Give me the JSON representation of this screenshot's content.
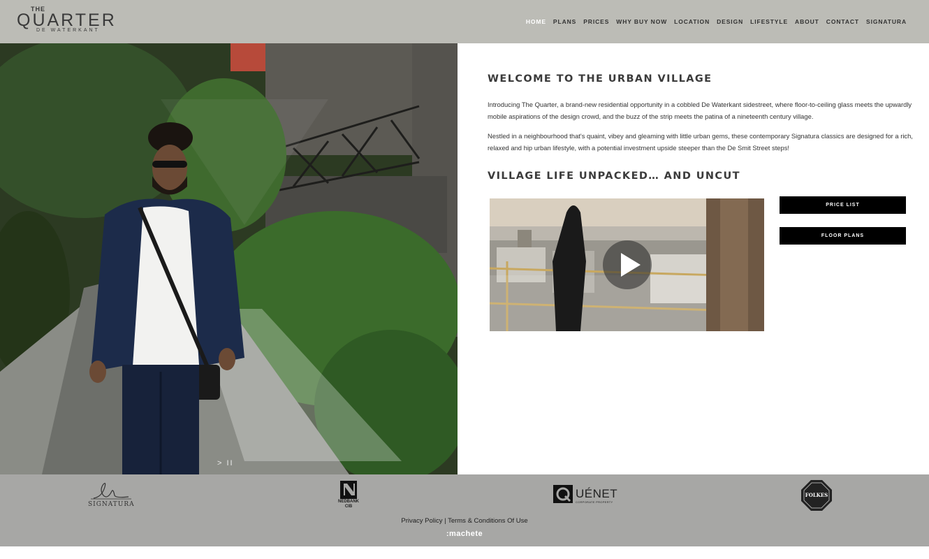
{
  "logo": {
    "line1": "THE",
    "line2": "QUARTER",
    "line3": "DE WATERKANT"
  },
  "nav": [
    {
      "label": "HOME",
      "active": true
    },
    {
      "label": "PLANS"
    },
    {
      "label": "PRICES"
    },
    {
      "label": "WHY BUY NOW"
    },
    {
      "label": "LOCATION"
    },
    {
      "label": "DESIGN"
    },
    {
      "label": "LIFESTYLE"
    },
    {
      "label": "ABOUT"
    },
    {
      "label": "CONTACT"
    },
    {
      "label": "SIGNATURA"
    }
  ],
  "hero": {
    "slider_controls": "> II"
  },
  "main": {
    "welcome_title": "WELCOME TO THE URBAN VILLAGE",
    "paragraph1": "Introducing The Quarter, a brand-new residential opportunity in a cobbled De Waterkant sidestreet, where floor-to-ceiling glass meets the upwardly mobile aspirations of the design crowd, and the buzz of the strip meets the patina of a nineteenth century village.",
    "paragraph2": "Nestled in a neighbourhood that's quaint, vibey and gleaming with little urban gems, these contemporary Signatura classics are designed for a rich, relaxed and hip urban lifestyle, with a potential investment upside steeper than the De Smit Street steps!",
    "video_title": "VILLAGE LIFE UNPACKED… AND UNCUT",
    "price_list_label": "PRICE LIST",
    "floor_plans_label": "FLOOR PLANS"
  },
  "footer": {
    "partners": {
      "signatura": "SIGNATURA",
      "nedbank_line1": "NEDBANK",
      "nedbank_line2": "CIB",
      "quenet": "UÉNET",
      "quenet_sub": "CORPORATE PROPERTY",
      "folkes": "FOLKES"
    },
    "privacy_label": "Privacy Policy",
    "separator": " | ",
    "terms_label": "Terms & Conditions Of Use",
    "credit": ":machete"
  },
  "colors": {
    "header_bg": "#bcbcb6",
    "footer_bg": "#a7a7a5",
    "button_bg": "#000000",
    "nav_active": "#ffffff"
  }
}
